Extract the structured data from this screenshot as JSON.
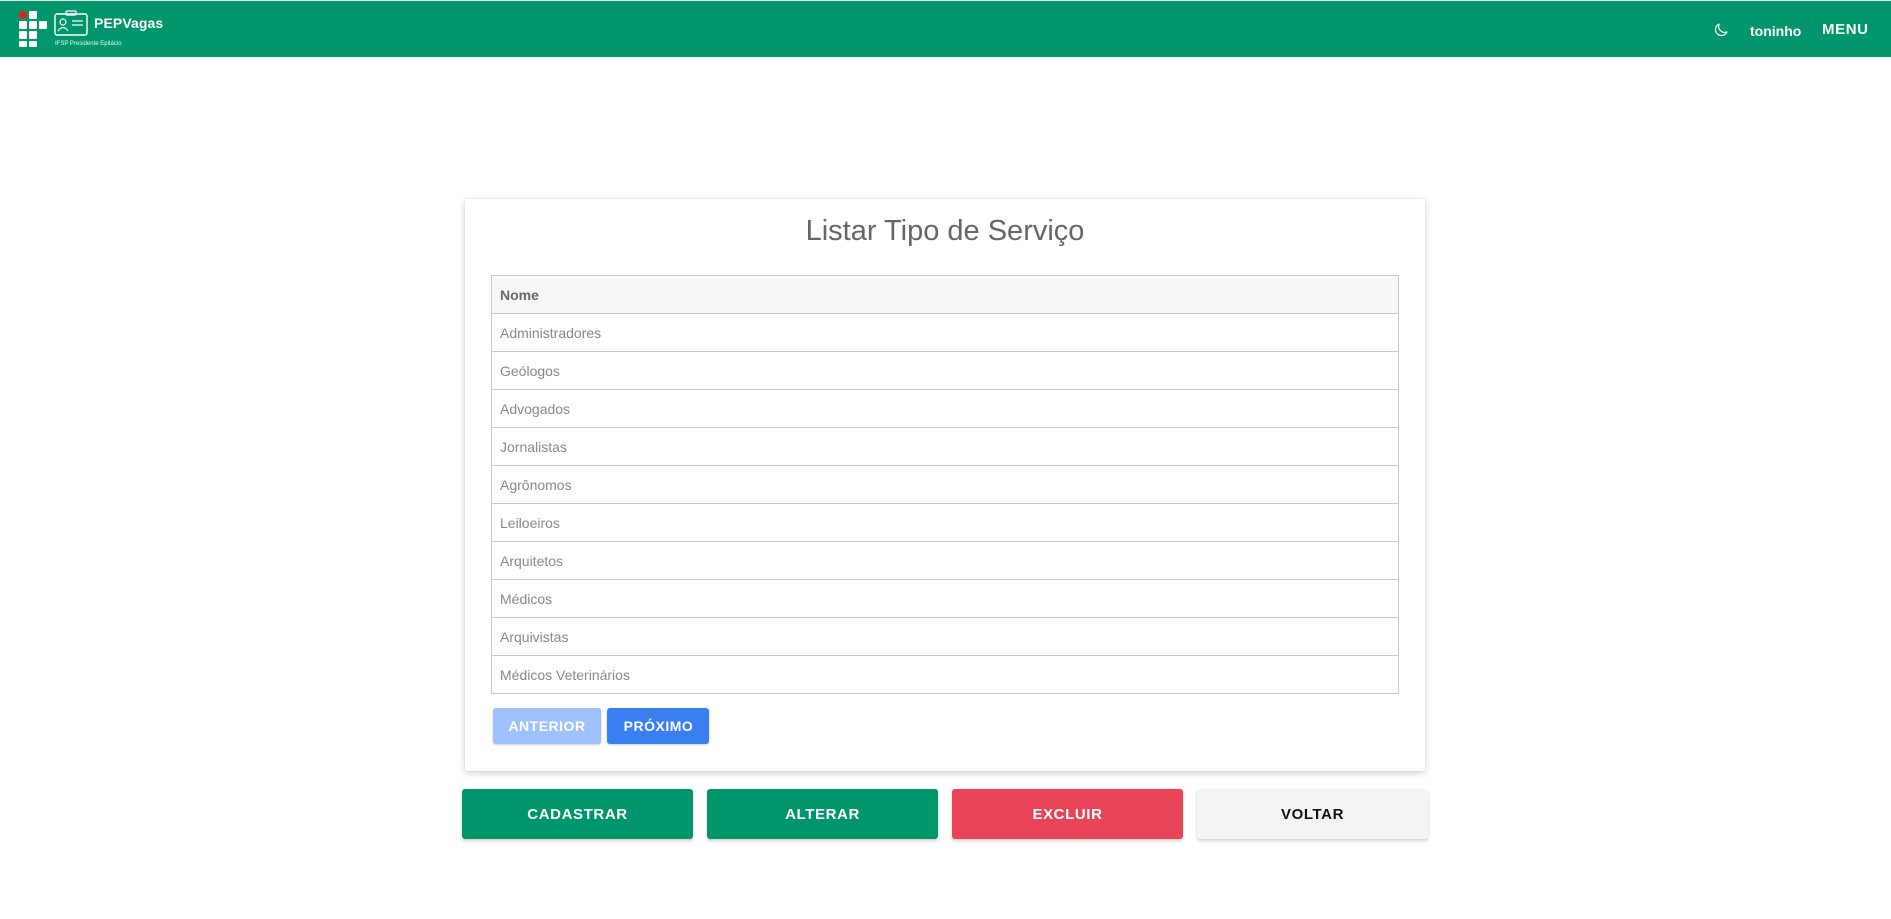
{
  "header": {
    "brand_title": "PEPVagas",
    "brand_subtitle": "IFSP Presidente Epitácio",
    "username": "toninho",
    "menu_label": "MENU",
    "icons": [
      "ifsp-logo-icon",
      "id-card-icon",
      "moon-icon"
    ]
  },
  "page": {
    "title": "Listar Tipo de Serviço"
  },
  "table": {
    "column_header": "Nome",
    "rows": [
      "Administradores",
      "Geólogos",
      "Advogados",
      "Jornalistas",
      "Agrônomos",
      "Leiloeiros",
      "Arquitetos",
      "Médicos",
      "Arquivistas",
      "Médicos Veterinários"
    ]
  },
  "pagination": {
    "prev_label": "ANTERIOR",
    "next_label": "PRÓXIMO"
  },
  "actions": {
    "cadastrar": "CADASTRAR",
    "alterar": "ALTERAR",
    "excluir": "EXCLUIR",
    "voltar": "VOLTAR"
  },
  "colors": {
    "primary": "#00956a",
    "danger": "#e84357",
    "pager_active": "#3a7ff2",
    "pager_disabled": "#9ec0fc"
  }
}
